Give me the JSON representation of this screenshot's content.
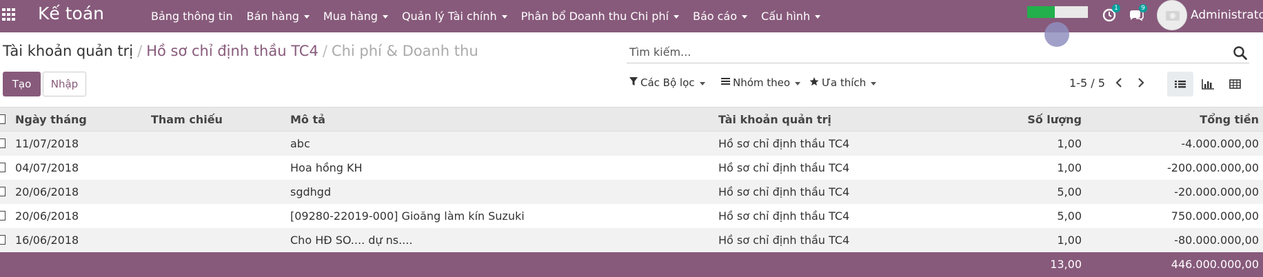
{
  "app": {
    "title": "Kế toán"
  },
  "menu": [
    {
      "label": "Bảng thông tin",
      "dropdown": false
    },
    {
      "label": "Bán hàng",
      "dropdown": true
    },
    {
      "label": "Mua hàng",
      "dropdown": true
    },
    {
      "label": "Quản lý Tài chính",
      "dropdown": true
    },
    {
      "label": "Phân bổ Doanh thu Chi phí",
      "dropdown": true
    },
    {
      "label": "Báo cáo",
      "dropdown": true
    },
    {
      "label": "Cấu hình",
      "dropdown": true
    }
  ],
  "systray": {
    "progress_fraction": 0.45,
    "activity_count": "1",
    "messages_count": "9",
    "user_name": "Administrator"
  },
  "breadcrumb": {
    "root": "Tài khoản quản trị",
    "mid": "Hồ sơ chỉ định thầu TC4",
    "current": "Chi phí & Doanh thu"
  },
  "search": {
    "placeholder": "Tìm kiếm..."
  },
  "buttons": {
    "create": "Tạo",
    "import": "Nhập"
  },
  "filters": {
    "filters": "Các Bộ lọc",
    "group_by": "Nhóm theo",
    "favorites": "Ưa thích"
  },
  "pager": {
    "value": "1-5 / 5"
  },
  "table": {
    "headers": {
      "date": "Ngày tháng",
      "ref": "Tham chiếu",
      "desc": "Mô tả",
      "account": "Tài khoản quản trị",
      "qty": "Số lượng",
      "total": "Tổng tiền"
    },
    "rows": [
      {
        "date": "11/07/2018",
        "ref": "",
        "desc": "abc",
        "account": "Hồ sơ chỉ định thầu TC4",
        "qty": "1,00",
        "total": "-4.000.000,00"
      },
      {
        "date": "04/07/2018",
        "ref": "",
        "desc": "Hoa hồng KH",
        "account": "Hồ sơ chỉ định thầu TC4",
        "qty": "1,00",
        "total": "-200.000.000,00"
      },
      {
        "date": "20/06/2018",
        "ref": "",
        "desc": "sgdhgd",
        "account": "Hồ sơ chỉ định thầu TC4",
        "qty": "5,00",
        "total": "-20.000.000,00"
      },
      {
        "date": "20/06/2018",
        "ref": "",
        "desc": "[09280-22019-000] Gioăng làm kín Suzuki",
        "account": "Hồ sơ chỉ định thầu TC4",
        "qty": "5,00",
        "total": "750.000.000,00"
      },
      {
        "date": "16/06/2018",
        "ref": "",
        "desc": "Cho HĐ SO.... dự ns....",
        "account": "Hồ sơ chỉ định thầu TC4",
        "qty": "1,00",
        "total": "-80.000.000,00"
      }
    ],
    "footer": {
      "qty": "13,00",
      "total": "446.000.000,00"
    }
  },
  "colors": {
    "brand": "#875a7b",
    "progress": "#21b04b",
    "badge": "#00a09d"
  }
}
